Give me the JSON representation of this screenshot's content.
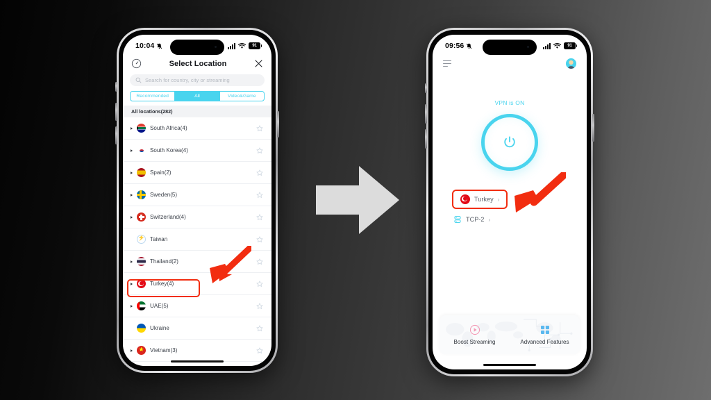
{
  "background": {
    "gradient_from": "#030303",
    "gradient_to": "#6e6e6e"
  },
  "accent": {
    "cyan": "#49d4ee",
    "red_highlight": "#f22d10",
    "pink": "#f39ab6",
    "blue": "#5ab8ef"
  },
  "center_arrow": {
    "name": "step-arrow",
    "color": "#dcdcdc",
    "direction": "right"
  },
  "left_phone": {
    "status_bar": {
      "time": "10:04",
      "bell_icon": "bell-slash-icon",
      "signal_icon": "cellular-signal-icon",
      "wifi_icon": "wifi-icon",
      "battery_level": "91"
    },
    "header": {
      "speed_icon": "speedometer-icon",
      "title": "Select Location",
      "close_icon": "close-x-icon"
    },
    "search": {
      "icon": "search-icon",
      "placeholder": "Search for country, city or streaming",
      "value": ""
    },
    "tabs": [
      {
        "label": "Recommended",
        "active": false
      },
      {
        "label": "All",
        "active": true
      },
      {
        "label": "Video&Game",
        "active": false
      }
    ],
    "section_header": "All locations(282)",
    "locations": [
      {
        "name": "South Africa(4)",
        "flag": "za",
        "expandable": true,
        "star": "star-outline-icon"
      },
      {
        "name": "South Korea(4)",
        "flag": "kr",
        "expandable": true,
        "star": "star-outline-icon"
      },
      {
        "name": "Spain(2)",
        "flag": "es",
        "expandable": true,
        "star": "star-outline-icon"
      },
      {
        "name": "Sweden(5)",
        "flag": "se",
        "expandable": true,
        "star": "star-outline-icon"
      },
      {
        "name": "Switzerland(4)",
        "flag": "ch",
        "expandable": true,
        "star": "star-outline-icon"
      },
      {
        "name": "Taiwan",
        "flag": "tw",
        "expandable": false,
        "star": "star-outline-icon"
      },
      {
        "name": "Thailand(2)",
        "flag": "th",
        "expandable": true,
        "star": "star-outline-icon"
      },
      {
        "name": "Turkey(4)",
        "flag": "tr",
        "expandable": true,
        "star": "star-outline-icon",
        "highlighted": true
      },
      {
        "name": "UAE(5)",
        "flag": "ae",
        "expandable": true,
        "star": "star-outline-icon"
      },
      {
        "name": "Ukraine",
        "flag": "ua",
        "expandable": false,
        "star": "star-outline-icon"
      },
      {
        "name": "Vietnam(3)",
        "flag": "vn",
        "expandable": true,
        "star": "star-outline-icon"
      }
    ],
    "annotation": {
      "name": "red-pointer-arrow",
      "points_to": "Turkey(4)",
      "color": "#f22d10"
    }
  },
  "right_phone": {
    "status_bar": {
      "time": "09:56",
      "bell_icon": "bell-slash-icon",
      "signal_icon": "cellular-signal-icon",
      "wifi_icon": "wifi-icon",
      "battery_level": "91"
    },
    "top_bar": {
      "menu_icon": "hamburger-menu-icon",
      "avatar_icon": "user-avatar-icon"
    },
    "vpn_status": "VPN is ON",
    "power_button": {
      "icon": "power-icon",
      "state": "on",
      "ring_color": "#49d4ee"
    },
    "server_chip": {
      "flag": "tr",
      "label": "Turkey",
      "chevron": "›",
      "highlighted": true
    },
    "protocol_chip": {
      "icon": "server-stack-icon",
      "label": "TCP-2",
      "chevron": "›",
      "highlighted": false
    },
    "bottom_actions": [
      {
        "icon": "play-circle-icon",
        "label": "Boost Streaming",
        "color": "#f39ab6"
      },
      {
        "icon": "grid-squares-icon",
        "label": "Advanced Features",
        "color": "#5ab8ef"
      }
    ],
    "annotation": {
      "name": "red-pointer-arrow",
      "points_to": "Turkey",
      "color": "#f22d10"
    }
  }
}
